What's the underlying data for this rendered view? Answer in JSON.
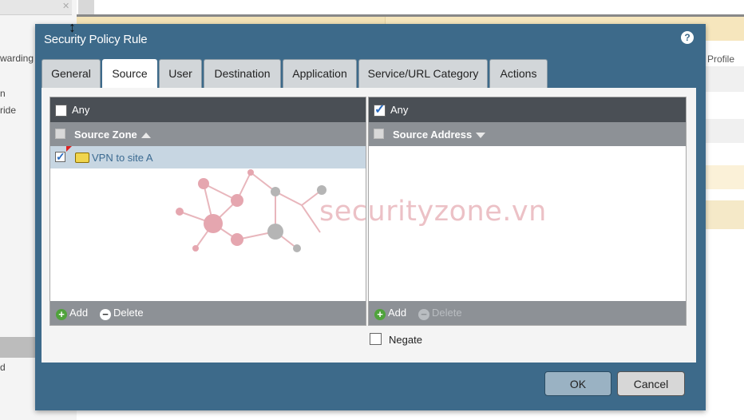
{
  "background": {
    "left_fragments": [
      "warding",
      "n",
      "ride",
      "d"
    ],
    "header_fragment": "Profile"
  },
  "dialog": {
    "title": "Security Policy Rule",
    "help_icon": "question-circle-icon",
    "tabs": [
      {
        "label": "General",
        "active": false
      },
      {
        "label": "Source",
        "active": true
      },
      {
        "label": "User",
        "active": false
      },
      {
        "label": "Destination",
        "active": false
      },
      {
        "label": "Application",
        "active": false
      },
      {
        "label": "Service/URL Category",
        "active": false
      },
      {
        "label": "Actions",
        "active": false
      }
    ],
    "source_zone": {
      "any_label": "Any",
      "any_checked": false,
      "column_header": "Source Zone",
      "rows": [
        {
          "label": "VPN to site A",
          "checked": true
        }
      ],
      "add_label": "Add",
      "delete_label": "Delete"
    },
    "source_address": {
      "any_label": "Any",
      "any_checked": true,
      "column_header": "Source Address",
      "rows": [],
      "add_label": "Add",
      "delete_label": "Delete"
    },
    "negate_label": "Negate",
    "ok_label": "OK",
    "cancel_label": "Cancel"
  },
  "watermark": "securityzone.vn",
  "colors": {
    "dialog_bg": "#3d6a8a",
    "grid_header_dark": "#4a4f55",
    "grid_header": "#8d9196",
    "selected_row": "#c7d6e2",
    "add_icon": "#4fa33b"
  }
}
